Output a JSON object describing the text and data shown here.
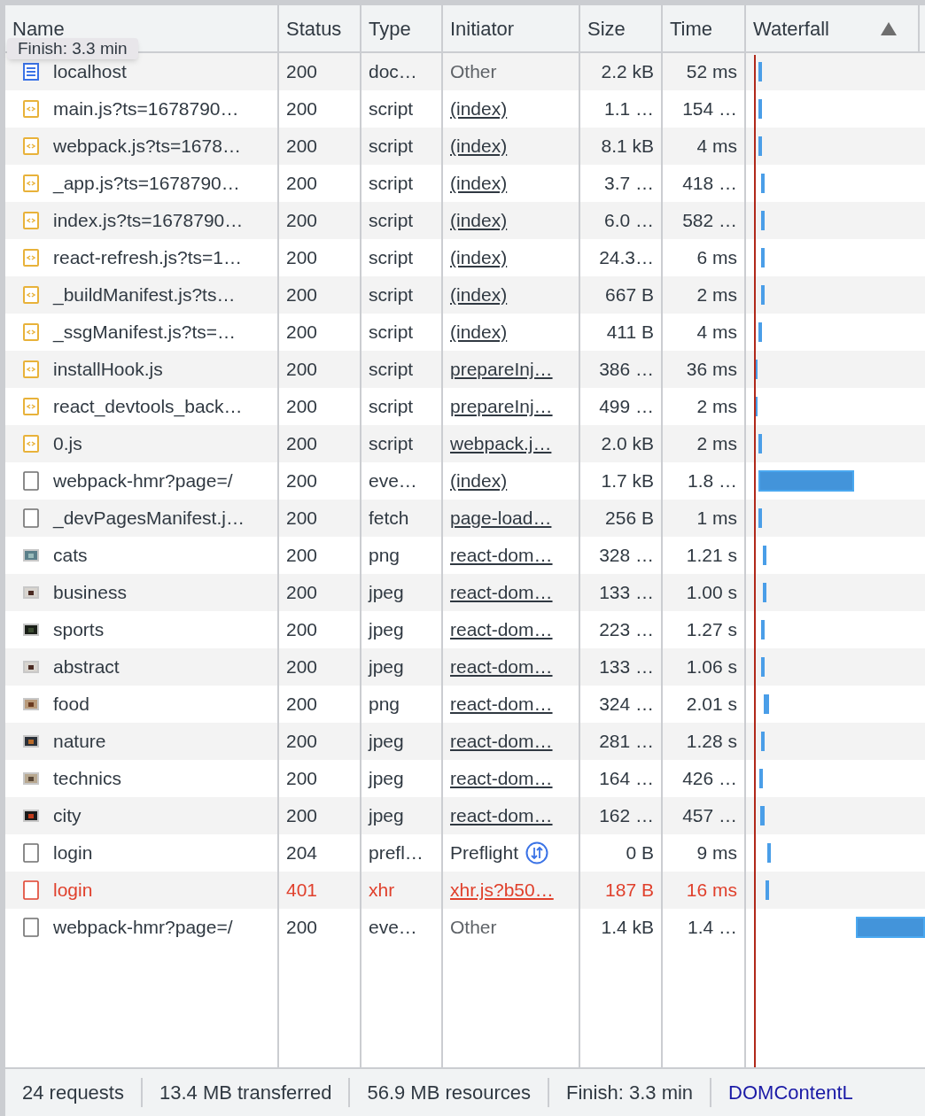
{
  "columns": [
    "Name",
    "Status",
    "Type",
    "Initiator",
    "Size",
    "Time",
    "Waterfall"
  ],
  "tooltip": "Finish: 3.3 min",
  "rows": [
    {
      "kind": "document",
      "name": "localhost",
      "status": "200",
      "type": "doc…",
      "initiator": {
        "kind": "other",
        "text": "Other"
      },
      "size": "2.2 kB",
      "time": "52 ms",
      "failed": false
    },
    {
      "kind": "script",
      "name": "main.js?ts=1678790…",
      "status": "200",
      "type": "script",
      "initiator": {
        "kind": "link",
        "text": "(index)"
      },
      "size": "1.1 …",
      "time": "154 …",
      "failed": false
    },
    {
      "kind": "script",
      "name": "webpack.js?ts=1678…",
      "status": "200",
      "type": "script",
      "initiator": {
        "kind": "link",
        "text": "(index)"
      },
      "size": "8.1 kB",
      "time": "4 ms",
      "failed": false
    },
    {
      "kind": "script",
      "name": "_app.js?ts=1678790…",
      "status": "200",
      "type": "script",
      "initiator": {
        "kind": "link",
        "text": "(index)"
      },
      "size": "3.7 …",
      "time": "418 …",
      "failed": false
    },
    {
      "kind": "script",
      "name": "index.js?ts=1678790…",
      "status": "200",
      "type": "script",
      "initiator": {
        "kind": "link",
        "text": "(index)"
      },
      "size": "6.0 …",
      "time": "582 …",
      "failed": false
    },
    {
      "kind": "script",
      "name": "react-refresh.js?ts=1…",
      "status": "200",
      "type": "script",
      "initiator": {
        "kind": "link",
        "text": "(index)"
      },
      "size": "24.3…",
      "time": "6 ms",
      "failed": false
    },
    {
      "kind": "script",
      "name": "_buildManifest.js?ts…",
      "status": "200",
      "type": "script",
      "initiator": {
        "kind": "link",
        "text": "(index)"
      },
      "size": "667 B",
      "time": "2 ms",
      "failed": false
    },
    {
      "kind": "script",
      "name": "_ssgManifest.js?ts=…",
      "status": "200",
      "type": "script",
      "initiator": {
        "kind": "link",
        "text": "(index)"
      },
      "size": "411 B",
      "time": "4 ms",
      "failed": false
    },
    {
      "kind": "script",
      "name": "installHook.js",
      "status": "200",
      "type": "script",
      "initiator": {
        "kind": "link",
        "text": "prepareInj…"
      },
      "size": "386 …",
      "time": "36 ms",
      "failed": false
    },
    {
      "kind": "script",
      "name": "react_devtools_back…",
      "status": "200",
      "type": "script",
      "initiator": {
        "kind": "link",
        "text": "prepareInj…"
      },
      "size": "499 …",
      "time": "2 ms",
      "failed": false
    },
    {
      "kind": "script",
      "name": "0.js",
      "status": "200",
      "type": "script",
      "initiator": {
        "kind": "link",
        "text": "webpack.j…"
      },
      "size": "2.0 kB",
      "time": "2 ms",
      "failed": false
    },
    {
      "kind": "blank",
      "name": "webpack-hmr?page=/",
      "status": "200",
      "type": "eve…",
      "initiator": {
        "kind": "link",
        "text": "(index)"
      },
      "size": "1.7 kB",
      "time": "1.8 …",
      "failed": false
    },
    {
      "kind": "blank",
      "name": "_devPagesManifest.j…",
      "status": "200",
      "type": "fetch",
      "initiator": {
        "kind": "link",
        "text": "page-load…"
      },
      "size": "256 B",
      "time": "1 ms",
      "failed": false
    },
    {
      "kind": "image",
      "name": "cats",
      "status": "200",
      "type": "png",
      "initiator": {
        "kind": "link",
        "text": "react-dom…"
      },
      "size": "328 …",
      "time": "1.21 s",
      "failed": false
    },
    {
      "kind": "image",
      "name": "business",
      "status": "200",
      "type": "jpeg",
      "initiator": {
        "kind": "link",
        "text": "react-dom…"
      },
      "size": "133 …",
      "time": "1.00 s",
      "failed": false
    },
    {
      "kind": "image",
      "name": "sports",
      "status": "200",
      "type": "jpeg",
      "initiator": {
        "kind": "link",
        "text": "react-dom…"
      },
      "size": "223 …",
      "time": "1.27 s",
      "failed": false
    },
    {
      "kind": "image",
      "name": "abstract",
      "status": "200",
      "type": "jpeg",
      "initiator": {
        "kind": "link",
        "text": "react-dom…"
      },
      "size": "133 …",
      "time": "1.06 s",
      "failed": false
    },
    {
      "kind": "image",
      "name": "food",
      "status": "200",
      "type": "png",
      "initiator": {
        "kind": "link",
        "text": "react-dom…"
      },
      "size": "324 …",
      "time": "2.01 s",
      "failed": false
    },
    {
      "kind": "image",
      "name": "nature",
      "status": "200",
      "type": "jpeg",
      "initiator": {
        "kind": "link",
        "text": "react-dom…"
      },
      "size": "281 …",
      "time": "1.28 s",
      "failed": false
    },
    {
      "kind": "image",
      "name": "technics",
      "status": "200",
      "type": "jpeg",
      "initiator": {
        "kind": "link",
        "text": "react-dom…"
      },
      "size": "164 …",
      "time": "426 …",
      "failed": false
    },
    {
      "kind": "image",
      "name": "city",
      "status": "200",
      "type": "jpeg",
      "initiator": {
        "kind": "link",
        "text": "react-dom…"
      },
      "size": "162 …",
      "time": "457 …",
      "failed": false
    },
    {
      "kind": "blank",
      "name": "login",
      "status": "204",
      "type": "prefl…",
      "initiator": {
        "kind": "preflight",
        "text": "Preflight"
      },
      "size": "0 B",
      "time": "9 ms",
      "failed": false
    },
    {
      "kind": "blank",
      "name": "login",
      "status": "401",
      "type": "xhr",
      "initiator": {
        "kind": "link",
        "text": "xhr.js?b50…"
      },
      "size": "187 B",
      "time": "16 ms",
      "failed": true
    },
    {
      "kind": "blank",
      "name": "webpack-hmr?page=/",
      "status": "200",
      "type": "eve…",
      "initiator": {
        "kind": "other",
        "text": "Other"
      },
      "size": "1.4 kB",
      "time": "1.4 …",
      "failed": false
    }
  ],
  "status_bar": [
    "24 requests",
    "13.4 MB transferred",
    "56.9 MB resources",
    "Finish: 3.3 min",
    "DOMContentL"
  ]
}
